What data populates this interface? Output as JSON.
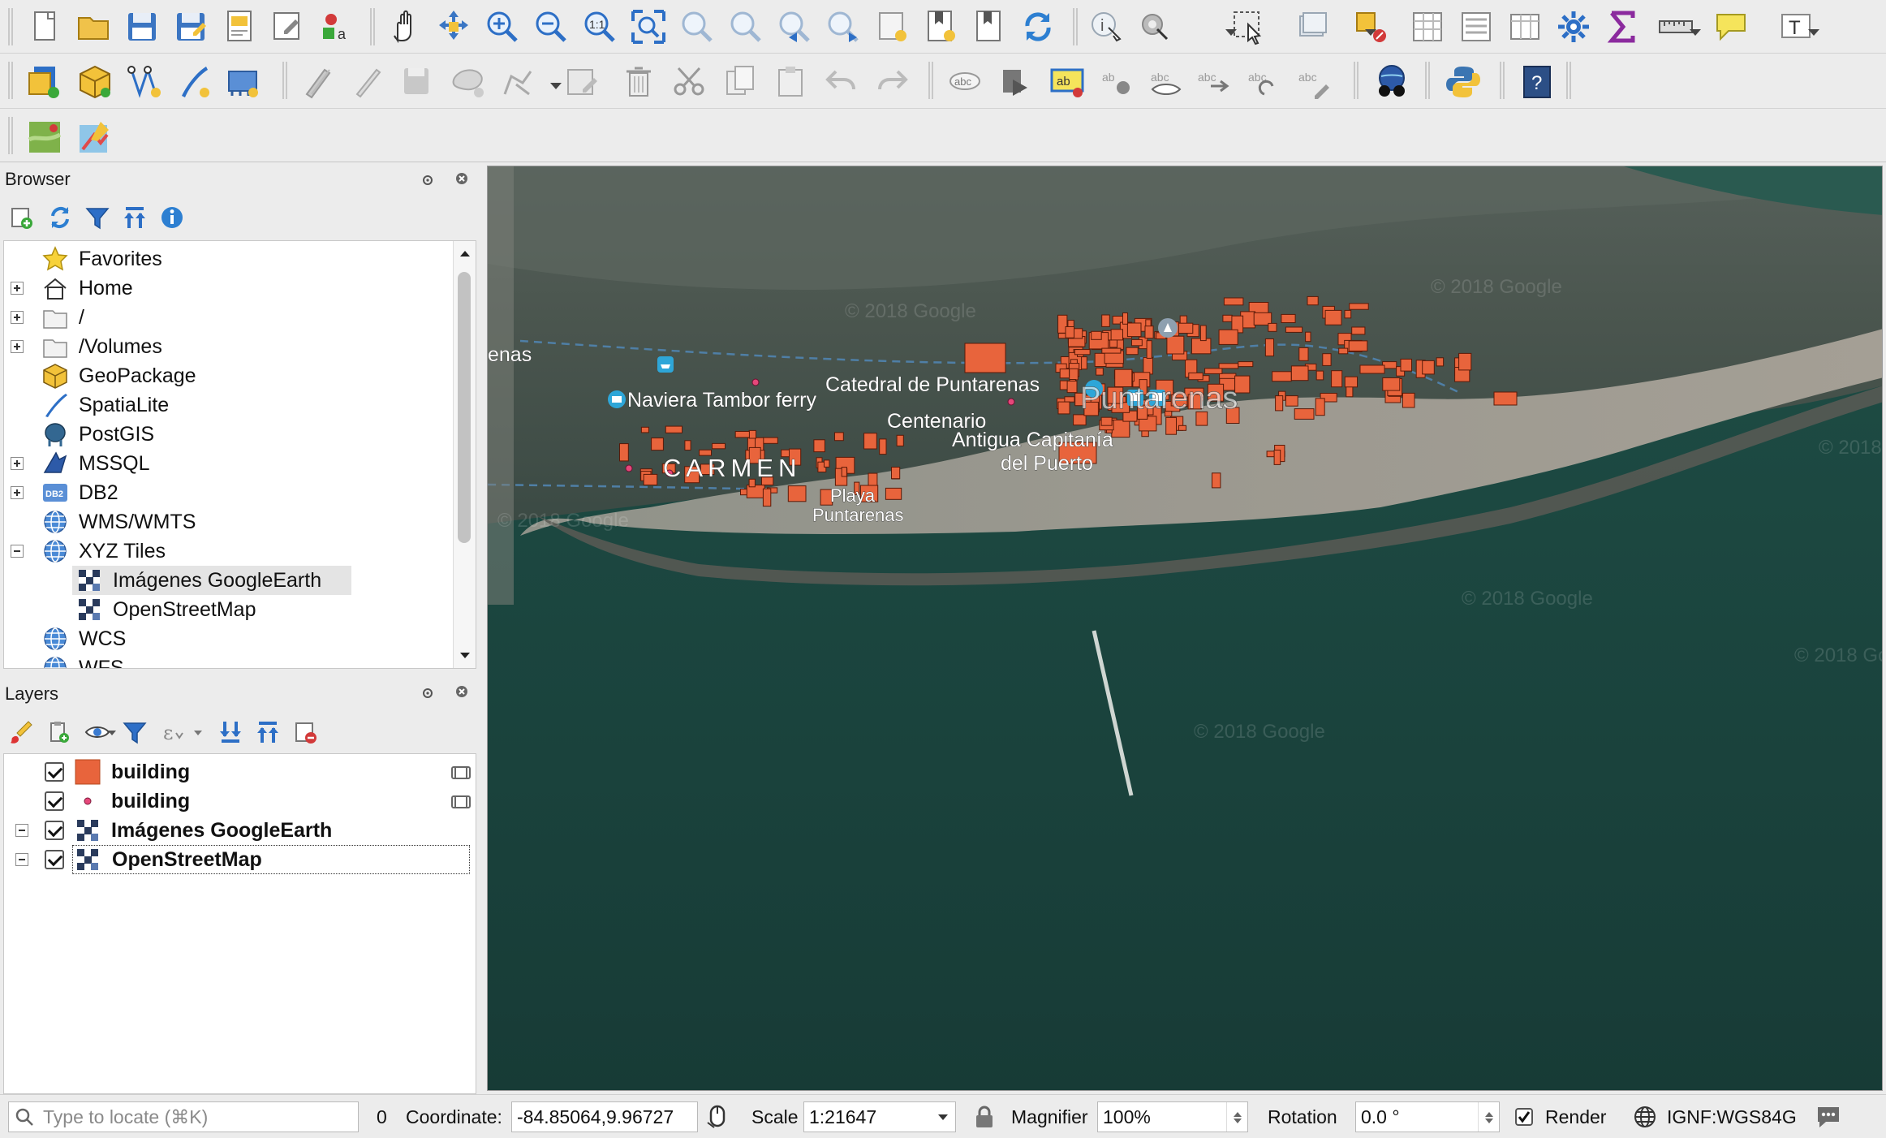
{
  "toolbar_rows": [
    [
      "new-project",
      "open-project",
      "save-project",
      "save-as",
      "new-print-layout",
      "style-manager",
      "style-manager-alt",
      "pan",
      "pan-to-selection",
      "zoom-in",
      "zoom-out",
      "zoom-native",
      "zoom-full",
      "zoom-to-selection",
      "zoom-to-layer",
      "zoom-last",
      "zoom-next",
      "new-spatial-bookmark",
      "show-bookmarks",
      "new-map-view",
      "refresh",
      "identify",
      "actions",
      "select-features",
      "deselect",
      "open-attribute-table",
      "statistics",
      "open-field-calculator",
      "field-calculator",
      "toolbox",
      "sum",
      "measure",
      "annotation",
      "text-annotation"
    ],
    [
      "data-source-manager",
      "new-geopackage-layer",
      "new-shapefile-layer",
      "new-spatialite-layer",
      "new-virtual-layer",
      "current-edits",
      "toggle-editing",
      "save-edits",
      "add-polygon",
      "vertex-tool",
      "modify-attributes",
      "delete-selected",
      "cut-features",
      "copy-features",
      "paste-features",
      "undo",
      "redo",
      "label-tool",
      "layer-labeling",
      "highlight-pinned",
      "pin-labels",
      "show-hide-labels",
      "preview-labels",
      "rotate-label",
      "change-label",
      "quickmapservices",
      "python-console",
      "help"
    ],
    [
      "georeferencer",
      "plugin-tool"
    ]
  ],
  "browser": {
    "title": "Browser",
    "items": [
      {
        "label": "Favorites",
        "icon": "star-icon",
        "expander": "none"
      },
      {
        "label": "Home",
        "icon": "home-icon",
        "expander": "plus"
      },
      {
        "label": "/",
        "icon": "folder-icon",
        "expander": "plus"
      },
      {
        "label": "/Volumes",
        "icon": "folder-icon",
        "expander": "plus"
      },
      {
        "label": "GeoPackage",
        "icon": "geopackage-icon",
        "expander": "none"
      },
      {
        "label": "SpatiaLite",
        "icon": "spatialite-icon",
        "expander": "none"
      },
      {
        "label": "PostGIS",
        "icon": "postgis-icon",
        "expander": "none"
      },
      {
        "label": "MSSQL",
        "icon": "mssql-icon",
        "expander": "plus"
      },
      {
        "label": "DB2",
        "icon": "db2-icon",
        "expander": "plus"
      },
      {
        "label": "WMS/WMTS",
        "icon": "globe-icon",
        "expander": "none"
      },
      {
        "label": "XYZ Tiles",
        "icon": "globe-icon",
        "expander": "minus"
      },
      {
        "label": "Imágenes GoogleEarth",
        "icon": "tile-layer-icon",
        "expander": "child",
        "selected": true
      },
      {
        "label": "OpenStreetMap",
        "icon": "tile-layer-icon",
        "expander": "child"
      },
      {
        "label": "WCS",
        "icon": "globe-icon",
        "expander": "none"
      },
      {
        "label": "WFS",
        "icon": "globe-icon",
        "expander": "none"
      }
    ]
  },
  "layers": {
    "title": "Layers",
    "items": [
      {
        "label": "building",
        "symbol": "fill",
        "checked": true,
        "expander": "none",
        "has_indicator": true
      },
      {
        "label": "building",
        "symbol": "point",
        "checked": true,
        "expander": "none",
        "has_indicator": true
      },
      {
        "label": "Imágenes GoogleEarth",
        "symbol": "raster",
        "checked": true,
        "expander": "minus",
        "has_indicator": false
      },
      {
        "label": "OpenStreetMap",
        "symbol": "raster",
        "checked": true,
        "expander": "minus",
        "has_indicator": false,
        "current": true
      }
    ]
  },
  "map": {
    "labels": {
      "carmen": "CARMEN",
      "playa": "Playa",
      "puntarenas_beach": "Puntarenas",
      "ferry": "Naviera Tambor ferry",
      "catedral": "Catedral de Puntarenas",
      "centro": "Centenario",
      "capitania": "Antigua Capitanía",
      "puerto": "del Puerto",
      "city": "Puntarenas",
      "west_edge": "enas"
    },
    "watermark": "© 2018 Google",
    "colors": {
      "building_fill": "#e8643c",
      "building_stroke": "#5a1a08",
      "point": "#e6477a",
      "water": "#1c4a42"
    }
  },
  "status": {
    "search_placeholder": "Type to locate (⌘K)",
    "message_count": "0",
    "coordinate_label": "Coordinate:",
    "coordinate_value": "-84.85064,9.96727",
    "scale_label": "Scale",
    "scale_value": "1:21647",
    "magnifier_label": "Magnifier",
    "magnifier_value": "100%",
    "rotation_label": "Rotation",
    "rotation_value": "0.0 °",
    "render_label": "Render",
    "render_checked": true,
    "crs": "IGNF:WGS84G"
  }
}
